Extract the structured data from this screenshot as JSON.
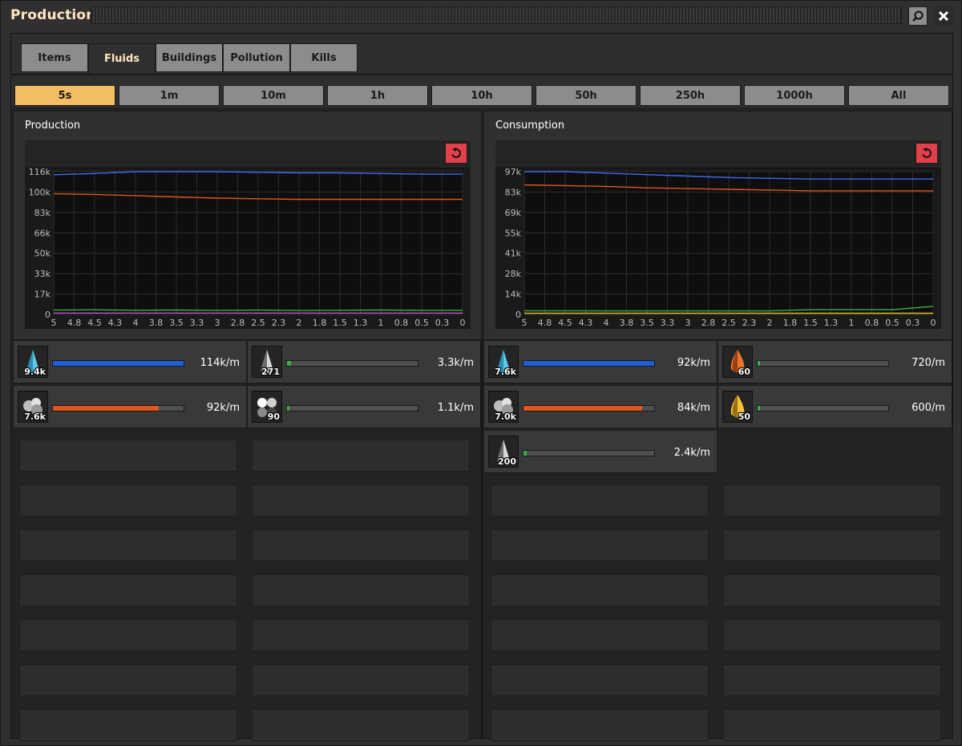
{
  "window": {
    "title": "Production"
  },
  "tabs": [
    {
      "label": "Items"
    },
    {
      "label": "Fluids"
    },
    {
      "label": "Buildings"
    },
    {
      "label": "Pollution"
    },
    {
      "label": "Kills"
    }
  ],
  "active_tab": "Fluids",
  "time_ranges": [
    {
      "label": "5s"
    },
    {
      "label": "1m"
    },
    {
      "label": "10m"
    },
    {
      "label": "1h"
    },
    {
      "label": "10h"
    },
    {
      "label": "50h"
    },
    {
      "label": "250h"
    },
    {
      "label": "1000h"
    },
    {
      "label": "All"
    }
  ],
  "active_time_range": "5s",
  "production": {
    "title": "Production",
    "rows": [
      {
        "icon": "steam-icon",
        "count": "9.4k",
        "rate": "114k/m",
        "fill": 1.0,
        "color": "#1d5fd6"
      },
      {
        "icon": "heavy-oil-icon",
        "count": "271",
        "rate": "3.3k/m",
        "fill": 0.03,
        "color": "#39b14a"
      },
      {
        "icon": "water-icon",
        "count": "7.6k",
        "rate": "92k/m",
        "fill": 0.81,
        "color": "#e0561b"
      },
      {
        "icon": "petroleum-gas-icon",
        "count": "90",
        "rate": "1.1k/m",
        "fill": 0.01,
        "color": "#39b14a"
      }
    ]
  },
  "consumption": {
    "title": "Consumption",
    "rows": [
      {
        "icon": "steam-icon",
        "count": "7.6k",
        "rate": "92k/m",
        "fill": 1.0,
        "color": "#1d5fd6"
      },
      {
        "icon": "crude-oil-icon",
        "count": "60",
        "rate": "720/m",
        "fill": 0.008,
        "color": "#39b14a"
      },
      {
        "icon": "water-icon",
        "count": "7.0k",
        "rate": "84k/m",
        "fill": 0.91,
        "color": "#e0561b"
      },
      {
        "icon": "lubricant-icon",
        "count": "50",
        "rate": "600/m",
        "fill": 0.007,
        "color": "#39b14a"
      },
      {
        "icon": "heavy-oil-icon",
        "count": "200",
        "rate": "2.4k/m",
        "fill": 0.026,
        "color": "#39b14a"
      }
    ]
  },
  "chart_data": [
    {
      "type": "line",
      "title": "Production",
      "x_ticks": [
        "5",
        "4.8",
        "4.5",
        "4.3",
        "4",
        "3.8",
        "3.5",
        "3.3",
        "3",
        "2.8",
        "2.5",
        "2.3",
        "2",
        "1.8",
        "1.5",
        "1.3",
        "1",
        "0.8",
        "0.5",
        "0.3",
        "0"
      ],
      "y_ticks": [
        "0",
        "17k",
        "33k",
        "50k",
        "66k",
        "83k",
        "100k",
        "116k"
      ],
      "xlim": [
        5,
        0
      ],
      "ylim": [
        0,
        116000
      ],
      "grid": true,
      "x": [
        5,
        4.5,
        4,
        3.5,
        3,
        2.5,
        2,
        1.5,
        1,
        0.5,
        0
      ],
      "series": [
        {
          "color": "#3d6cf0",
          "values": [
            113500,
            114500,
            116000,
            116000,
            116000,
            115500,
            115000,
            115000,
            114500,
            114000,
            114000
          ]
        },
        {
          "color": "#e0561b",
          "values": [
            98000,
            97500,
            96500,
            95500,
            94500,
            94000,
            93500,
            93500,
            93500,
            93500,
            93500
          ]
        },
        {
          "color": "#39b14a",
          "values": [
            3500,
            3800,
            3400,
            3600,
            3300,
            3500,
            3200,
            3400,
            3600,
            3300,
            3400
          ]
        },
        {
          "color": "#d04fd0",
          "values": [
            1100,
            1100,
            1100,
            1100,
            1100,
            1100,
            1100,
            1100,
            1100,
            1100,
            1100
          ]
        }
      ]
    },
    {
      "type": "line",
      "title": "Consumption",
      "x_ticks": [
        "5",
        "4.8",
        "4.5",
        "4.3",
        "4",
        "3.8",
        "3.5",
        "3.3",
        "3",
        "2.8",
        "2.5",
        "2.3",
        "2",
        "1.8",
        "1.5",
        "1.3",
        "1",
        "0.8",
        "0.5",
        "0.3",
        "0"
      ],
      "y_ticks": [
        "0",
        "14k",
        "28k",
        "41k",
        "55k",
        "69k",
        "83k",
        "97k"
      ],
      "xlim": [
        5,
        0
      ],
      "ylim": [
        0,
        97000
      ],
      "grid": true,
      "x": [
        5,
        4.5,
        4,
        3.5,
        3,
        2.5,
        2,
        1.5,
        1,
        0.5,
        0
      ],
      "series": [
        {
          "color": "#3d6cf0",
          "values": [
            97000,
            97000,
            96000,
            95000,
            94000,
            93000,
            92500,
            92000,
            92000,
            92000,
            92000
          ]
        },
        {
          "color": "#e0561b",
          "values": [
            88000,
            87500,
            87000,
            86000,
            85500,
            85000,
            84500,
            84000,
            84000,
            84000,
            84000
          ]
        },
        {
          "color": "#39b14a",
          "values": [
            2500,
            2500,
            2400,
            2400,
            2400,
            2400,
            2400,
            3200,
            3200,
            3200,
            5500
          ]
        },
        {
          "color": "#e6b820",
          "values": [
            800,
            800,
            800,
            800,
            800,
            800,
            800,
            800,
            800,
            800,
            800
          ]
        }
      ]
    }
  ]
}
